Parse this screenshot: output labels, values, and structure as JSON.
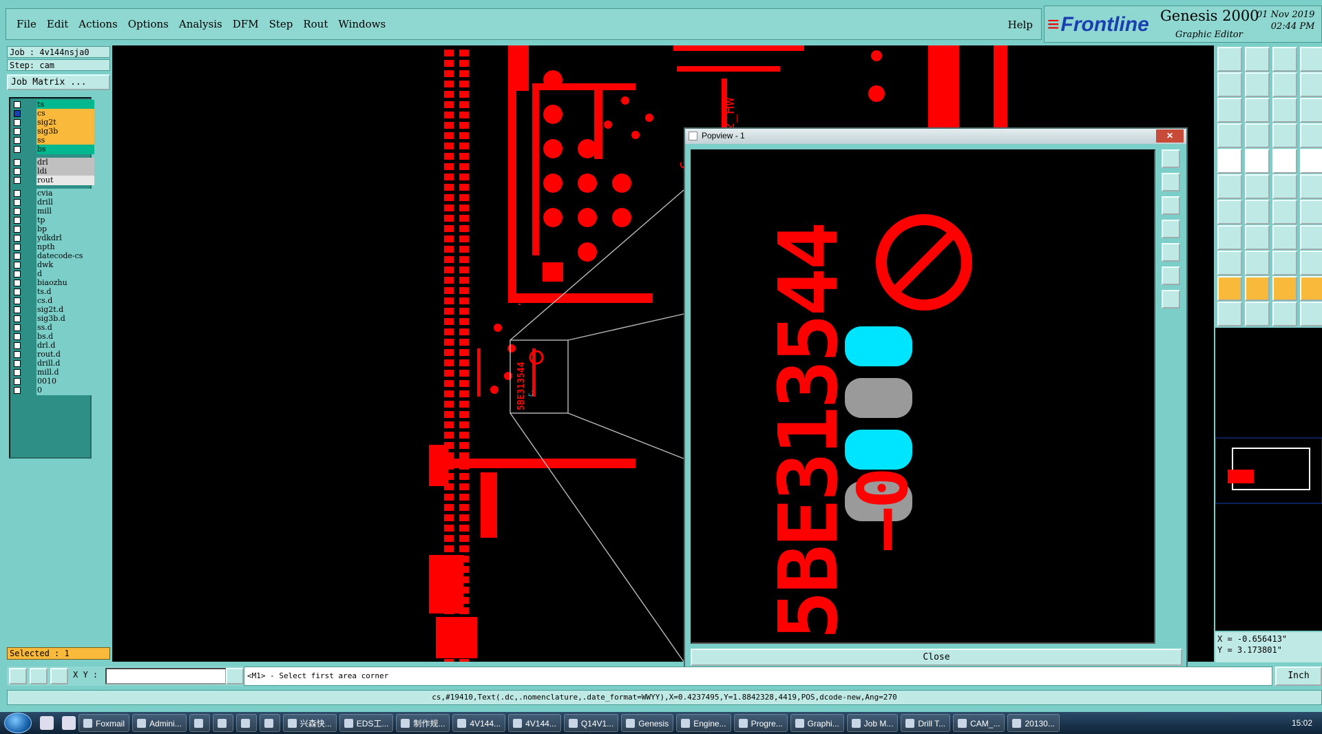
{
  "menu": [
    "File",
    "Edit",
    "Actions",
    "Options",
    "Analysis",
    "DFM",
    "Step",
    "Rout",
    "Windows"
  ],
  "help_label": "Help",
  "brand": {
    "logo": "Frontline",
    "product": "Genesis 2000",
    "subtitle": "Graphic Editor",
    "date": "01 Nov 2019",
    "time": "02:44 PM"
  },
  "job": {
    "job_label": "Job : 4v144nsja0",
    "step_label": "Step: cam",
    "matrix_label": "Job Matrix ..."
  },
  "layers": [
    {
      "name": "ts",
      "color": "#00b890",
      "checked": false
    },
    {
      "name": "cs",
      "color": "#f9b93a",
      "checked": true
    },
    {
      "name": "sig2t",
      "color": "#f9b93a",
      "checked": false
    },
    {
      "name": "sig3b",
      "color": "#f9b93a",
      "checked": false
    },
    {
      "name": "ss",
      "color": "#f9b93a",
      "checked": false
    },
    {
      "name": "bs",
      "color": "#00b890",
      "checked": false
    },
    {
      "name": "drl",
      "color": "#c0c0c0",
      "checked": false
    },
    {
      "name": "ldi",
      "color": "#c0c0c0",
      "checked": false
    },
    {
      "name": "rout",
      "color": "#e8e8e8",
      "checked": false
    },
    {
      "name": "cvia",
      "color": "#7ccfc9",
      "checked": false
    },
    {
      "name": "drill",
      "color": "#7ccfc9",
      "checked": false
    },
    {
      "name": "mill",
      "color": "#7ccfc9",
      "checked": false
    },
    {
      "name": "tp",
      "color": "#7ccfc9",
      "checked": false
    },
    {
      "name": "bp",
      "color": "#7ccfc9",
      "checked": false
    },
    {
      "name": "ydkdrl",
      "color": "#7ccfc9",
      "checked": false
    },
    {
      "name": "npth",
      "color": "#7ccfc9",
      "checked": false
    },
    {
      "name": "datecode-cs",
      "color": "#7ccfc9",
      "checked": false
    },
    {
      "name": "dwk",
      "color": "#7ccfc9",
      "checked": false
    },
    {
      "name": "d",
      "color": "#7ccfc9",
      "checked": false
    },
    {
      "name": "biaozhu",
      "color": "#7ccfc9",
      "checked": false
    },
    {
      "name": "ts.d",
      "color": "#7ccfc9",
      "checked": false
    },
    {
      "name": "cs.d",
      "color": "#7ccfc9",
      "checked": false
    },
    {
      "name": "sig2t.d",
      "color": "#7ccfc9",
      "checked": false
    },
    {
      "name": "sig3b.d",
      "color": "#7ccfc9",
      "checked": false
    },
    {
      "name": "ss.d",
      "color": "#7ccfc9",
      "checked": false
    },
    {
      "name": "bs.d",
      "color": "#7ccfc9",
      "checked": false
    },
    {
      "name": "drl.d",
      "color": "#7ccfc9",
      "checked": false
    },
    {
      "name": "rout.d",
      "color": "#7ccfc9",
      "checked": false
    },
    {
      "name": "drill.d",
      "color": "#7ccfc9",
      "checked": false
    },
    {
      "name": "mill.d",
      "color": "#7ccfc9",
      "checked": false
    },
    {
      "name": "0010",
      "color": "#7ccfc9",
      "checked": false
    },
    {
      "name": "0",
      "color": "#7ccfc9",
      "checked": false
    }
  ],
  "selected_label": "Selected : 1",
  "popup": {
    "title": "Popview - 1",
    "close_label": "Close",
    "zoom_text": "5BE313544",
    "zoom_code": "—0"
  },
  "canvas_labels": {
    "rot_text1": "SQ52_HW",
    "rot_text2": "C."
  },
  "coords": {
    "x": "X = -0.656413\"",
    "y": "Y = 3.173801\""
  },
  "xy_label": "X Y :",
  "xy_value": "",
  "prompt": "<M1> - Select first area corner",
  "unit": "Inch",
  "status": "cs,#19410,Text(.dc,.nomenclature,.date_format=WWYY),X=0.4237495,Y=1.8842328,4419,POS,dcode-new,Ang=270",
  "taskbar": {
    "items": [
      "Foxmail",
      "Admini...",
      "",
      "",
      "",
      "",
      "兴森快...",
      "EDS工...",
      "制作规...",
      "4V144...",
      "4V144...",
      "Q14V1...",
      "Genesis",
      "Engine...",
      "Progre...",
      "Graphi...",
      "Job M...",
      "Drill T...",
      "CAM_...",
      "20130..."
    ],
    "clock": "15:02"
  },
  "colors": {
    "copper": "#ff0000",
    "cyan": "#00e5ff",
    "panel": "#7ccfc9"
  }
}
